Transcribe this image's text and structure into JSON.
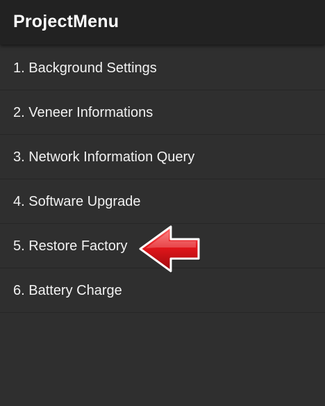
{
  "app_bar": {
    "title": "ProjectMenu"
  },
  "menu": {
    "items": [
      {
        "label": "1. Background Settings"
      },
      {
        "label": "2. Veneer Informations"
      },
      {
        "label": "3. Network Information Query"
      },
      {
        "label": "4. Software Upgrade"
      },
      {
        "label": "5. Restore Factory"
      },
      {
        "label": "6. Battery Charge"
      }
    ]
  },
  "annotation": {
    "icon": "red-arrow-left-icon",
    "color": "#e3161b",
    "target_item": "5. Restore Factory"
  },
  "colors": {
    "background": "#2f2f2f",
    "app_bar": "#222222",
    "divider": "#262626",
    "text": "#f2f2f2"
  }
}
